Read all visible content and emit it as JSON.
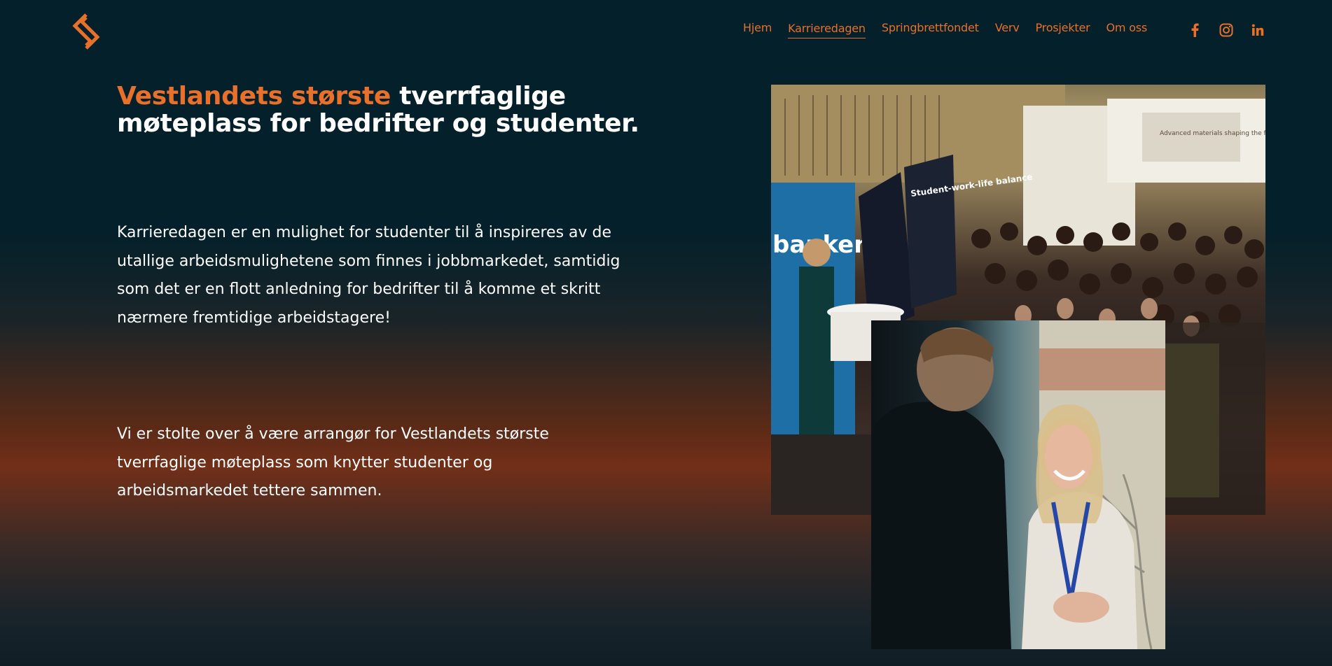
{
  "nav": {
    "items": [
      {
        "label": "Hjem",
        "active": false
      },
      {
        "label": "Karrieredagen",
        "active": true
      },
      {
        "label": "Springbrettfondet",
        "active": false
      },
      {
        "label": "Verv",
        "active": false
      },
      {
        "label": "Prosjekter",
        "active": false
      },
      {
        "label": "Om oss",
        "active": false
      }
    ]
  },
  "social": {
    "icons": [
      "facebook-icon",
      "instagram-icon",
      "linkedin-icon"
    ]
  },
  "hero": {
    "headline_accent": "Vestlandets største",
    "headline_rest": " tverrfaglige møteplass for bedrifter og studenter.",
    "paragraph_1": "Karrieredagen er en mulighet for studenter til å inspireres av de utallige arbeidsmulighetene som finnes i jobbmarkedet, samtidig som det er en flott anledning for bedrifter til å komme et skritt nærmere fremtidige arbeidstagere!",
    "paragraph_2": "Vi er stolte over å være arrangør for Vestlandets største tverrfaglige møteplass som knytter studenter og arbeidsmarkedet tettere sammen."
  },
  "photos": {
    "crowd_sign_1": "Student-work-life balance",
    "crowd_sign_2": "banken",
    "crowd_sign_3": "Advanced materials shaping the future"
  },
  "colors": {
    "accent": "#e8702a",
    "background_top": "#03202b",
    "background_mid": "#722f18"
  }
}
